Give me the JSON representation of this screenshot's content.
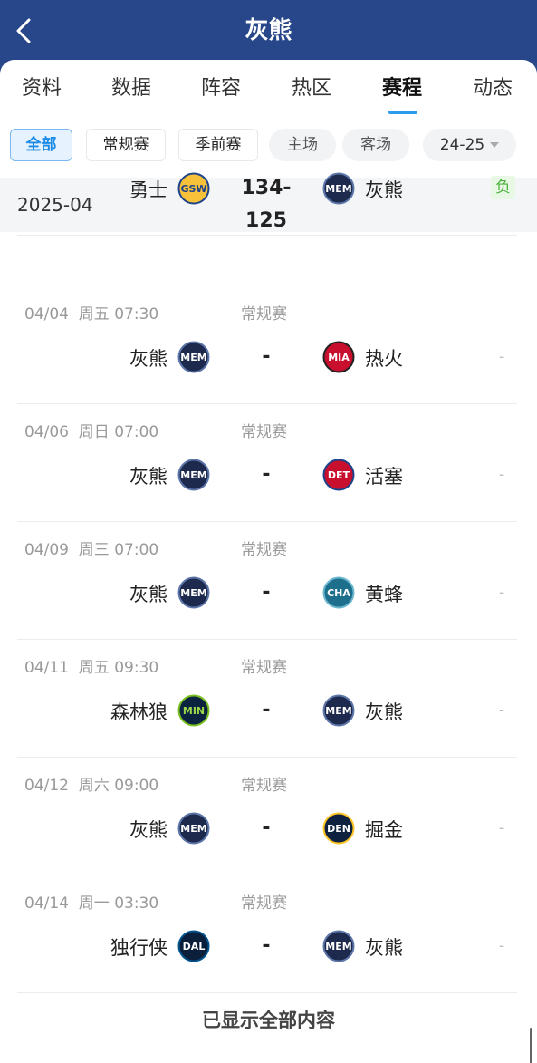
{
  "header": {
    "title": "灰熊"
  },
  "tabs": [
    {
      "label": "资料",
      "active": false
    },
    {
      "label": "数据",
      "active": false
    },
    {
      "label": "阵容",
      "active": false
    },
    {
      "label": "热区",
      "active": false
    },
    {
      "label": "赛程",
      "active": true
    },
    {
      "label": "动态",
      "active": false
    }
  ],
  "filters": {
    "all": "全部",
    "regular": "常规赛",
    "preseason": "季前赛",
    "home": "主场",
    "away": "客场",
    "season": "24-25"
  },
  "month": "2025-04",
  "colors": {
    "header_bg": "#27478a",
    "accent": "#2b9bf0",
    "loss": "#4cb13e"
  },
  "games": [
    {
      "date": "",
      "type": "",
      "home": "勇士",
      "home_logo": "GSW",
      "score": "134-125",
      "away": "灰熊",
      "away_logo": "MEM",
      "result": "负"
    },
    {
      "date": "04/04  周五 07:30",
      "type": "常规赛",
      "home": "灰熊",
      "home_logo": "MEM",
      "score": "-",
      "away": "热火",
      "away_logo": "MIA",
      "result": "-"
    },
    {
      "date": "04/06  周日 07:00",
      "type": "常规赛",
      "home": "灰熊",
      "home_logo": "MEM",
      "score": "-",
      "away": "活塞",
      "away_logo": "DET",
      "result": "-"
    },
    {
      "date": "04/09  周三 07:00",
      "type": "常规赛",
      "home": "灰熊",
      "home_logo": "MEM",
      "score": "-",
      "away": "黄蜂",
      "away_logo": "CHA",
      "result": "-"
    },
    {
      "date": "04/11  周五 09:30",
      "type": "常规赛",
      "home": "森林狼",
      "home_logo": "MIN",
      "score": "-",
      "away": "灰熊",
      "away_logo": "MEM",
      "result": "-"
    },
    {
      "date": "04/12  周六 09:00",
      "type": "常规赛",
      "home": "灰熊",
      "home_logo": "MEM",
      "score": "-",
      "away": "掘金",
      "away_logo": "DEN",
      "result": "-"
    },
    {
      "date": "04/14  周一 03:30",
      "type": "常规赛",
      "home": "独行侠",
      "home_logo": "DAL",
      "score": "-",
      "away": "灰熊",
      "away_logo": "MEM",
      "result": "-"
    }
  ],
  "footer": "已显示全部内容"
}
